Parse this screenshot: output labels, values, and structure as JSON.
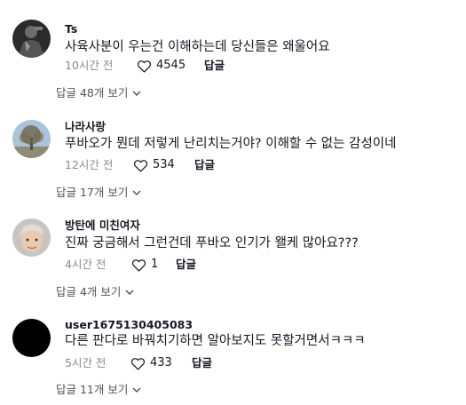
{
  "comments": [
    {
      "username": "Ts",
      "text": "사육사분이 우는건 이해하는데 당신들은 왜울어요",
      "time": "10시간 전",
      "likes": "4545",
      "reply_label": "답글",
      "view_replies": "답글 48개 보기"
    },
    {
      "username": "나라사랑",
      "text": "푸바오가 뭔데 저렇게 난리치는거야? 이해할 수 없는 감성이네",
      "time": "12시간 전",
      "likes": "534",
      "reply_label": "답글",
      "view_replies": "답글 17개 보기"
    },
    {
      "username": "방탄에 미친여자",
      "text": "진짜 궁금해서 그런건데 푸바오 인기가 왤케 많아요???",
      "time": "4시간 전",
      "likes": "1",
      "reply_label": "답글",
      "view_replies": "답글 4개 보기"
    },
    {
      "username": "user1675130405083",
      "text": "다른 판다로 바꿔치기하면 알아보지도 못할거면서ㅋㅋㅋ",
      "time": "5시간 전",
      "likes": "433",
      "reply_label": "답글",
      "view_replies": "답글 11개 보기"
    }
  ],
  "colors": {
    "primary_text": "#161823",
    "secondary_text": "#8a8b91",
    "view_replies_text": "#545559"
  },
  "icons": {
    "like": "heart-outline-icon",
    "expand": "chevron-down-icon"
  }
}
